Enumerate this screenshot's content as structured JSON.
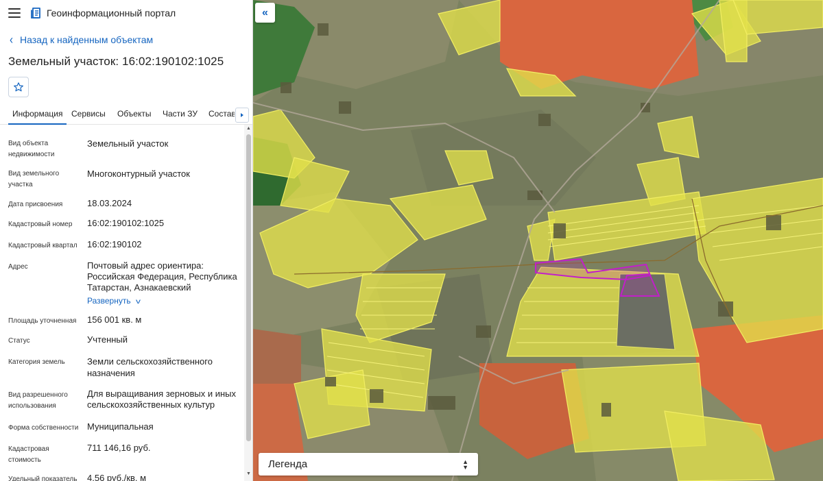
{
  "app": {
    "title": "Геоинформационный портал"
  },
  "nav": {
    "back_label": "Назад к найденным объектам"
  },
  "object": {
    "title": "Земельный участок: 16:02:190102:1025"
  },
  "tabs": [
    "Информация",
    "Сервисы",
    "Объекты",
    "Части ЗУ",
    "Состав"
  ],
  "info": {
    "rows": [
      {
        "label": "Вид объекта недвижимости",
        "value": "Земельный участок"
      },
      {
        "label": "Вид земельного участка",
        "value": "Многоконтурный участок"
      },
      {
        "label": "Дата присвоения",
        "value": "18.03.2024"
      },
      {
        "label": "Кадастровый номер",
        "value": "16:02:190102:1025"
      },
      {
        "label": "Кадастровый квартал",
        "value": "16:02:190102"
      },
      {
        "label": "Адрес",
        "value": "Почтовый адрес ориентира: Российская Федерация, Республика Татарстан, Азнакаевский"
      },
      {
        "label": "Площадь уточненная",
        "value": "156 001 кв. м"
      },
      {
        "label": "Статус",
        "value": "Учтенный"
      },
      {
        "label": "Категория земель",
        "value": "Земли сельскохозяйственного назначения"
      },
      {
        "label": "Вид разрешенного использования",
        "value": "Для выращивания зерновых и иных сельскохозяйственных культур"
      },
      {
        "label": "Форма собственности",
        "value": "Муниципальная"
      },
      {
        "label": "Кадастровая стоимость",
        "value": "711 146,16 руб."
      },
      {
        "label": "Удельный показатель",
        "value": "4,56 руб./кв. м"
      }
    ],
    "expand_label": "Развернуть"
  },
  "map": {
    "legend_label": "Легенда"
  },
  "colors": {
    "accent": "#1565c0",
    "selected_parcel": "#c21fc9",
    "parcel_fill": "#e2e04a",
    "parcel_border": "#f2ee63",
    "building": "#e0643c"
  },
  "icons": {
    "menu": "burger-menu-icon",
    "logo": "portal-logo-icon",
    "back": "chevron-left-icon",
    "favorite": "star-icon",
    "tab_next": "triangle-right-icon",
    "collapse": "double-chevron-left-icon",
    "expand": "chevron-down-icon",
    "legend_toggle": "unfold-icon"
  }
}
